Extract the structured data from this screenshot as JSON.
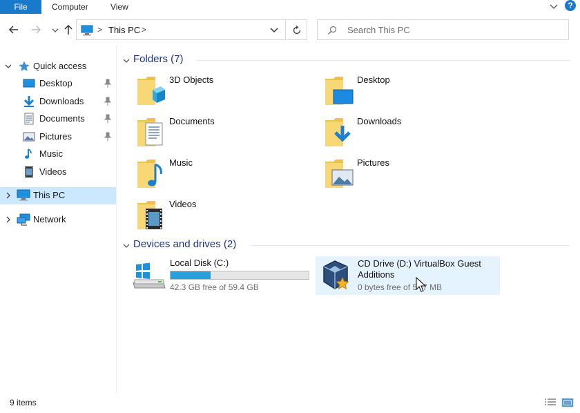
{
  "ribbon": {
    "tabs": [
      "File",
      "Computer",
      "View"
    ]
  },
  "address": {
    "crumb": "This PC",
    "separator": ">"
  },
  "search": {
    "placeholder": "Search This PC"
  },
  "sidebar": {
    "quick_access": "Quick access",
    "items": [
      {
        "label": "Desktop",
        "icon": "desktop-icon",
        "pinned": true
      },
      {
        "label": "Downloads",
        "icon": "downloads-icon",
        "pinned": true
      },
      {
        "label": "Documents",
        "icon": "documents-icon",
        "pinned": true
      },
      {
        "label": "Pictures",
        "icon": "pictures-icon",
        "pinned": true
      },
      {
        "label": "Music",
        "icon": "music-icon",
        "pinned": false
      },
      {
        "label": "Videos",
        "icon": "videos-icon",
        "pinned": false
      }
    ],
    "this_pc": "This PC",
    "network": "Network"
  },
  "folders": {
    "header": "Folders (7)",
    "items": [
      "3D Objects",
      "Desktop",
      "Documents",
      "Downloads",
      "Music",
      "Pictures",
      "Videos"
    ]
  },
  "devices": {
    "header": "Devices and drives (2)",
    "local_disk": {
      "name": "Local Disk (C:)",
      "free": "42.3 GB free of 59.4 GB",
      "used_fraction": 0.288
    },
    "cd_drive": {
      "name_line1": "CD Drive (D:) VirtualBox Guest",
      "name_line2": "Additions",
      "free": "0 bytes free of 5",
      "free_tail": "7 MB"
    }
  },
  "status": {
    "items": "9 items"
  },
  "colors": {
    "accent": "#1979ca",
    "selection": "#cce8ff",
    "hover": "#e5f3ff",
    "header_text": "#1e3287",
    "progress": "#26a0da"
  }
}
